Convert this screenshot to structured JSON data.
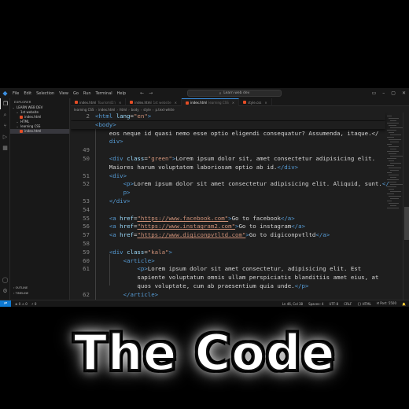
{
  "titlebar": {
    "menu": [
      "File",
      "Edit",
      "Selection",
      "View",
      "Go",
      "Run",
      "Terminal",
      "Help"
    ],
    "command_center": "Learn web dev"
  },
  "sidebar": {
    "title": "EXPLORER",
    "root": "LEARN WEB DEV",
    "tree": [
      {
        "label": "1st website",
        "indent": 1,
        "kind": "folder"
      },
      {
        "label": "index.html",
        "indent": 2,
        "kind": "file"
      },
      {
        "label": "HTML",
        "indent": 1,
        "kind": "folder"
      },
      {
        "label": "learning CSS",
        "indent": 1,
        "kind": "folder"
      },
      {
        "label": "index.html",
        "indent": 2,
        "kind": "file",
        "selected": true
      }
    ],
    "outline_label": "OUTLINE",
    "timeline_label": "TIMELINE"
  },
  "tabs": [
    {
      "label": "index.html",
      "dir": "Tourism\\D:\\"
    },
    {
      "label": "index.html",
      "dir": "1st website"
    },
    {
      "label": "index.html",
      "dir": "learning CSS",
      "active": true
    },
    {
      "label": "style.css",
      "dir": ""
    }
  ],
  "breadcrumb": [
    "learning CSS",
    "index.html",
    "html",
    "body",
    "style",
    "p.text-white"
  ],
  "editor": {
    "lines": [
      {
        "n": "2",
        "sticky": true,
        "tokens": [
          [
            "tag",
            "<html"
          ],
          [
            "txt",
            " "
          ],
          [
            "attr",
            "lang"
          ],
          [
            "txt",
            "="
          ],
          [
            "str",
            "\"en\""
          ],
          [
            "tag",
            ">"
          ]
        ]
      },
      {
        "n": "",
        "sticky": true,
        "tokens": [
          [
            "tag",
            "<body>"
          ]
        ]
      },
      {
        "n": "",
        "tokens": [
          [
            "txt",
            "    eos neque id quasi nemo esse optio eligendi consequatur? Assumenda, itaque.</"
          ]
        ]
      },
      {
        "n": "",
        "tokens": [
          [
            "txt",
            "    "
          ],
          [
            "tag",
            "div>"
          ]
        ]
      },
      {
        "n": "49",
        "tokens": []
      },
      {
        "n": "50",
        "tokens": [
          [
            "txt",
            "    "
          ],
          [
            "tag",
            "<div"
          ],
          [
            "txt",
            " "
          ],
          [
            "attr",
            "class"
          ],
          [
            "txt",
            "="
          ],
          [
            "str",
            "\"green\""
          ],
          [
            "tag",
            ">"
          ],
          [
            "txt",
            "Lorem ipsum dolor sit, amet consectetur adipisicing elit."
          ]
        ]
      },
      {
        "n": "",
        "tokens": [
          [
            "txt",
            "    Maiores harum voluptatem laboriosam optio ab id."
          ],
          [
            "tag",
            "</div>"
          ]
        ]
      },
      {
        "n": "51",
        "tokens": [
          [
            "txt",
            "    "
          ],
          [
            "tag",
            "<div>"
          ]
        ]
      },
      {
        "n": "52",
        "tokens": [
          [
            "txt",
            "        "
          ],
          [
            "tag",
            "<p>"
          ],
          [
            "txt",
            "Lorem ipsum dolor sit amet consectetur adipisicing elit. Aliquid, sunt."
          ],
          [
            "tag",
            "</"
          ]
        ]
      },
      {
        "n": "",
        "tokens": [
          [
            "txt",
            "        "
          ],
          [
            "tag",
            "p>"
          ]
        ]
      },
      {
        "n": "53",
        "tokens": [
          [
            "txt",
            "    "
          ],
          [
            "tag",
            "</div>"
          ]
        ]
      },
      {
        "n": "54",
        "tokens": []
      },
      {
        "n": "55",
        "tokens": [
          [
            "txt",
            "    "
          ],
          [
            "tag",
            "<a"
          ],
          [
            "txt",
            " "
          ],
          [
            "attr",
            "href"
          ],
          [
            "txt",
            "="
          ],
          [
            "link",
            "\"https://www.facebook.com\""
          ],
          [
            "tag",
            ">"
          ],
          [
            "txt",
            "Go to facebook"
          ],
          [
            "tag",
            "</a>"
          ]
        ]
      },
      {
        "n": "56",
        "tokens": [
          [
            "txt",
            "    "
          ],
          [
            "tag",
            "<a"
          ],
          [
            "txt",
            " "
          ],
          [
            "attr",
            "href"
          ],
          [
            "txt",
            "="
          ],
          [
            "link",
            "\"https://www.instagram2.com\""
          ],
          [
            "tag",
            ">"
          ],
          [
            "txt",
            "Go to instagram"
          ],
          [
            "tag",
            "</a>"
          ]
        ]
      },
      {
        "n": "57",
        "tokens": [
          [
            "txt",
            "    "
          ],
          [
            "tag",
            "<a"
          ],
          [
            "txt",
            " "
          ],
          [
            "attr",
            "href"
          ],
          [
            "txt",
            "="
          ],
          [
            "link",
            "\"https://www.digiconpvtltd.com\""
          ],
          [
            "tag",
            ">"
          ],
          [
            "txt",
            "Go to digiconpvtltd"
          ],
          [
            "tag",
            "</a>"
          ]
        ]
      },
      {
        "n": "58",
        "tokens": []
      },
      {
        "n": "59",
        "tokens": [
          [
            "txt",
            "    "
          ],
          [
            "tag",
            "<div"
          ],
          [
            "txt",
            " "
          ],
          [
            "attr",
            "class"
          ],
          [
            "txt",
            "="
          ],
          [
            "str",
            "\"kala\""
          ],
          [
            "tag",
            ">"
          ]
        ]
      },
      {
        "n": "60",
        "tokens": [
          [
            "txt",
            "        "
          ],
          [
            "tag",
            "<article>"
          ]
        ]
      },
      {
        "n": "61",
        "tokens": [
          [
            "txt",
            "            "
          ],
          [
            "tag",
            "<p>"
          ],
          [
            "txt",
            "Lorem ipsum dolor sit amet consectetur, adipisicing elit. Est"
          ]
        ]
      },
      {
        "n": "",
        "tokens": [
          [
            "txt",
            "            sapiente voluptatum omnis ullam perspiciatis blanditiis amet eius, at"
          ]
        ]
      },
      {
        "n": "",
        "tokens": [
          [
            "txt",
            "            quos voluptate, cum ab praesentium quia unde."
          ],
          [
            "tag",
            "</p>"
          ]
        ]
      },
      {
        "n": "62",
        "tokens": [
          [
            "txt",
            "        "
          ],
          [
            "tag",
            "</article>"
          ]
        ]
      },
      {
        "n": "63",
        "tokens": [
          [
            "txt",
            "    "
          ],
          [
            "tag",
            "</div>"
          ]
        ]
      }
    ]
  },
  "statusbar": {
    "left": [
      "⊗ 0  ⚠ 0",
      "⚡ 0"
    ],
    "right": [
      "Ln 46, Col 38",
      "Spaces: 4",
      "UTF-8",
      "CRLF",
      "{} HTML",
      "🗎 Port: 5500",
      "🔔"
    ]
  },
  "caption": "The Code"
}
